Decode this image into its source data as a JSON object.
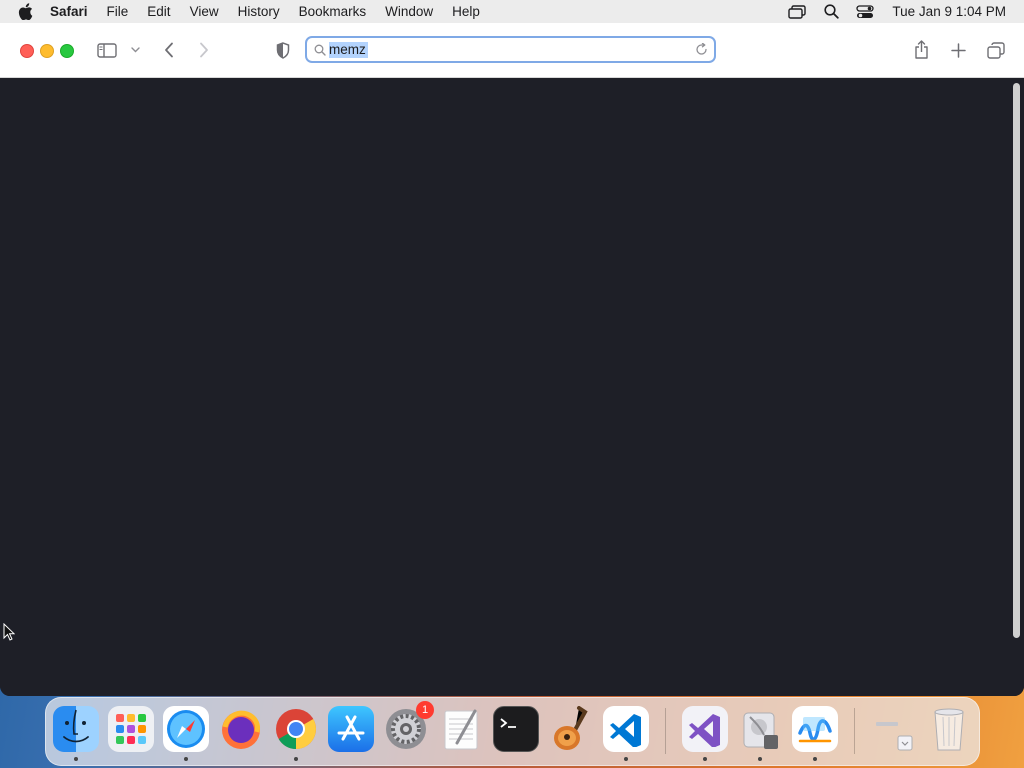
{
  "menubar": {
    "app_name": "Safari",
    "items": [
      "File",
      "Edit",
      "View",
      "History",
      "Bookmarks",
      "Window",
      "Help"
    ],
    "clock": "Tue Jan 9  1:04 PM"
  },
  "address_bar": {
    "value": "memz"
  },
  "dock": {
    "badge_system_settings": "1"
  }
}
